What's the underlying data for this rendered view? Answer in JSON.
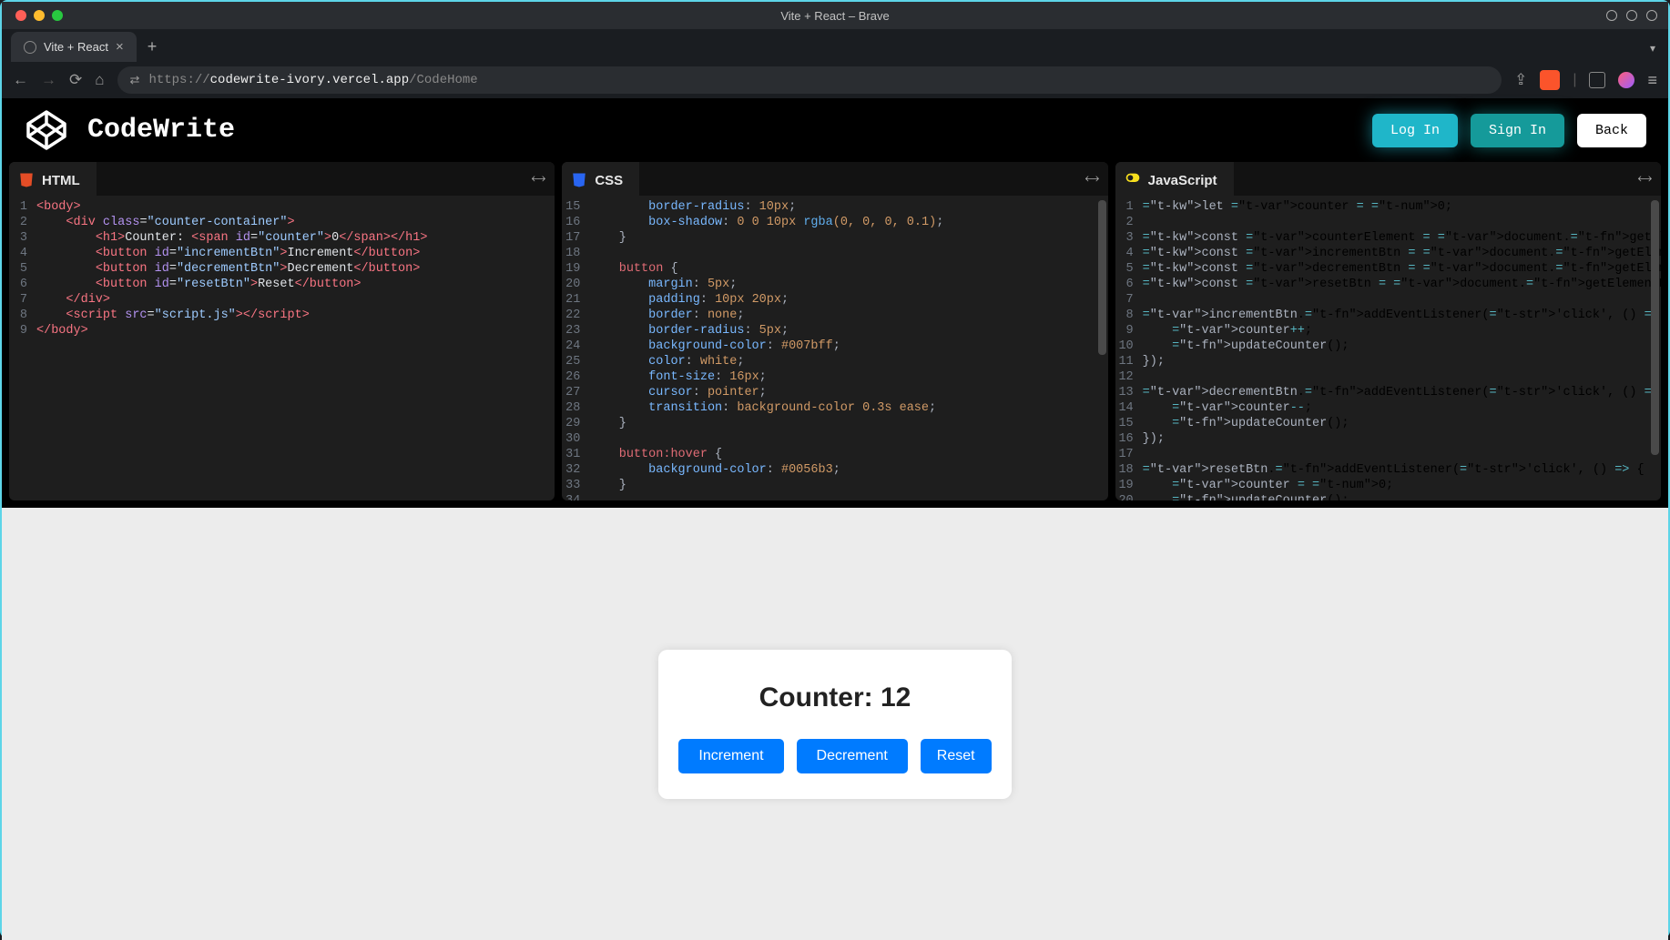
{
  "browser": {
    "window_title": "Vite + React – Brave",
    "tab_title": "Vite + React",
    "url_scheme": "https://",
    "url_host": "codewrite-ivory.vercel.app",
    "url_path": "/CodeHome"
  },
  "app": {
    "title": "CodeWrite",
    "buttons": {
      "login": "Log In",
      "signin": "Sign In",
      "back": "Back"
    }
  },
  "editors": {
    "html": {
      "title": "HTML",
      "start": 1,
      "lines": [
        "<body>",
        "    <div class=\"counter-container\">",
        "        <h1>Counter: <span id=\"counter\">0</span></h1>",
        "        <button id=\"incrementBtn\">Increment</button>",
        "        <button id=\"decrementBtn\">Decrement</button>",
        "        <button id=\"resetBtn\">Reset</button>",
        "    </div>",
        "    <script src=\"script.js\"></script>",
        "</body>"
      ]
    },
    "css": {
      "title": "CSS",
      "start": 15,
      "lines": [
        "        border-radius: 10px;",
        "        box-shadow: 0 0 10px rgba(0, 0, 0, 0.1);",
        "    }",
        "",
        "    button {",
        "        margin: 5px;",
        "        padding: 10px 20px;",
        "        border: none;",
        "        border-radius: 5px;",
        "        background-color: #007bff;",
        "        color: white;",
        "        font-size: 16px;",
        "        cursor: pointer;",
        "        transition: background-color 0.3s ease;",
        "    }",
        "",
        "    button:hover {",
        "        background-color: #0056b3;",
        "    }",
        ""
      ]
    },
    "js": {
      "title": "JavaScript",
      "start": 1,
      "lines": [
        "let counter = 0;",
        "",
        "const counterElement = document.getElementById('counter');",
        "const incrementBtn = document.getElementById('incrementBtn');",
        "const decrementBtn = document.getElementById('decrementBtn');",
        "const resetBtn = document.getElementById('resetBtn');",
        "",
        "incrementBtn.addEventListener('click', () => {",
        "    counter++;",
        "    updateCounter();",
        "});",
        "",
        "decrementBtn.addEventListener('click', () => {",
        "    counter--;",
        "    updateCounter();",
        "});",
        "",
        "resetBtn.addEventListener('click', () => {",
        "    counter = 0;",
        "    updateCounter();"
      ]
    }
  },
  "preview": {
    "heading_prefix": "Counter: ",
    "counter_value": "12",
    "buttons": {
      "increment": "Increment",
      "decrement": "Decrement",
      "reset": "Reset"
    }
  }
}
